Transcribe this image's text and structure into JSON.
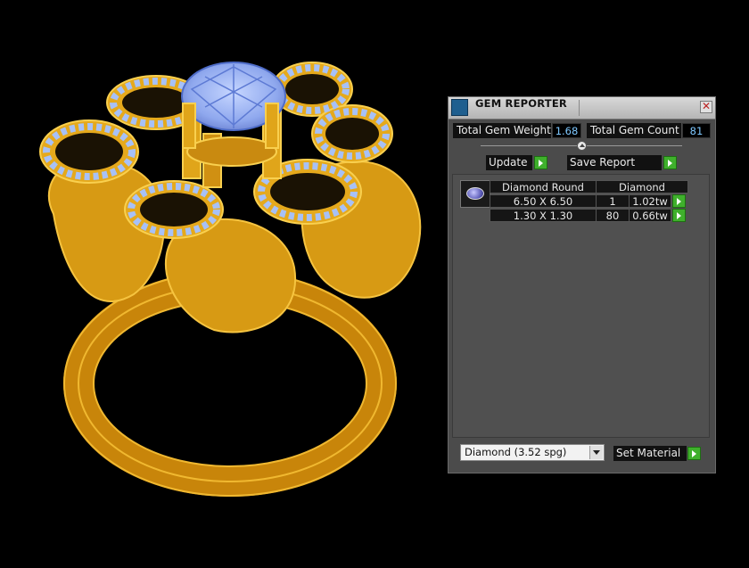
{
  "panel": {
    "title": "GEM REPORTER",
    "close_glyph": "✕",
    "stats": {
      "weight_label": "Total Gem Weight",
      "weight_value": "1.68",
      "count_label": "Total Gem Count",
      "count_value": "81"
    },
    "update_label": "Update",
    "save_label": "Save Report",
    "table": {
      "header": {
        "shape": "Diamond Round",
        "material": "Diamond"
      },
      "rows": [
        {
          "size": "6.50 X 6.50",
          "count": "1",
          "weight": "1.02tw"
        },
        {
          "size": "1.30 X 1.30",
          "count": "80",
          "weight": "0.66tw"
        }
      ]
    },
    "material_select": {
      "value": "Diamond      (3.52 spg)"
    },
    "set_material_label": "Set Material"
  },
  "colors": {
    "gold": "#e0a51a",
    "gem": "#9ab8f2",
    "panel": "#4b4b4b",
    "go_button": "#3fb02c"
  },
  "icons": [
    "app-icon",
    "close-icon",
    "slider-knob",
    "play-arrow-icon",
    "dropdown-arrow-icon"
  ]
}
